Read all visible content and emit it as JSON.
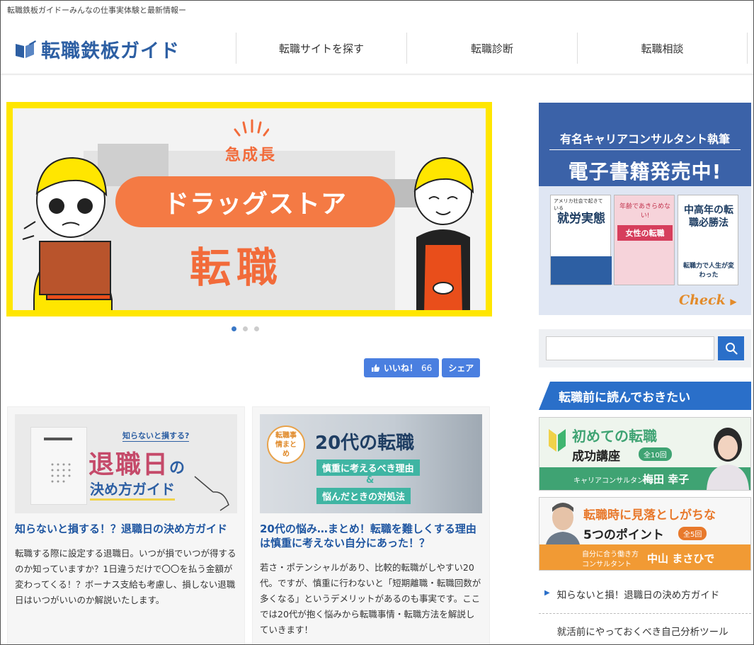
{
  "header": {
    "tagline": "転職鉄板ガイドーみんなの仕事実体験と最新情報ー",
    "logo_text": "転職鉄板ガイド",
    "brand_color": "#2d5fa3",
    "nav": [
      {
        "label": "転職サイトを探す"
      },
      {
        "label": "転職診断"
      },
      {
        "label": "転職相談"
      }
    ]
  },
  "hero": {
    "subtitle": "急成長",
    "main_title": "ドラッグストア",
    "word": "転職",
    "accent_color": "#f47a44",
    "frame_color": "#ffe600",
    "slides": 3,
    "active_slide": 1
  },
  "social": {
    "like_label": "いいね！",
    "like_count": "66",
    "share_label": "シェア"
  },
  "cards": [
    {
      "thumb_label_small": "知らないと損する?",
      "thumb_title_a": "退職日",
      "thumb_title_b": "の",
      "thumb_title_c": "決め方ガイド",
      "title": "知らないと損する！？退職日の決め方ガイド",
      "excerpt": "転職する際に設定する退職日。いつが損でいつが得するのか知っていますか？1日違うだけで〇〇を払う金額が変わってくる！？ボーナス支給も考慮し、損しない退職日はいつがいいのか解説いたします。"
    },
    {
      "thumb_badge": "転職事情まとめ",
      "thumb_title": "20代の転職",
      "thumb_line1": "慎重に考えるべき理由",
      "thumb_amp": "&",
      "thumb_line2": "悩んだときの対処法",
      "title": "20代の悩み…まとめ！転職を難しくする理由は慎重に考えない自分にあった！？",
      "excerpt": "若さ・ポテンシャルがあり、比較的転職がしやすい20代。ですが、慎重に行わないと「短期離職・転職回数が多くなる」というデメリットがあるのも事実です。ここでは20代が抱く悩みから転職事情・転職方法を解説していきます！"
    }
  ],
  "sidebar": {
    "banner": {
      "line1": "有名キャリアコンサルタント執筆",
      "line2": "電子書籍発売中!",
      "books": [
        {
          "title": "就労実態",
          "caption": "アメリカ社会で起きている"
        },
        {
          "title": "女性の転職",
          "caption": "年齢であきらめない!"
        },
        {
          "title": "中高年の転職必勝法",
          "caption": "転職力で人生が変わった"
        }
      ],
      "check": "Check"
    },
    "search": {
      "placeholder": "",
      "value": ""
    },
    "heading": "転職前に読んでおきたい",
    "banner1": {
      "title": "初めての転職",
      "sub": "成功講座",
      "badge": "全10回",
      "role": "キャリアコンサルタント",
      "person": "梅田 幸子"
    },
    "banner2": {
      "title": "転職時に見落としがちな",
      "sub": "5つのポイント",
      "badge": "全5回",
      "role1": "自分に合う働き方",
      "role2": "コンサルタント",
      "person": "中山 まさひで"
    },
    "links": [
      {
        "label": "知らないと損！退職日の決め方ガイド"
      },
      {
        "label": "就活前にやっておくべき自己分析ツール"
      }
    ]
  }
}
